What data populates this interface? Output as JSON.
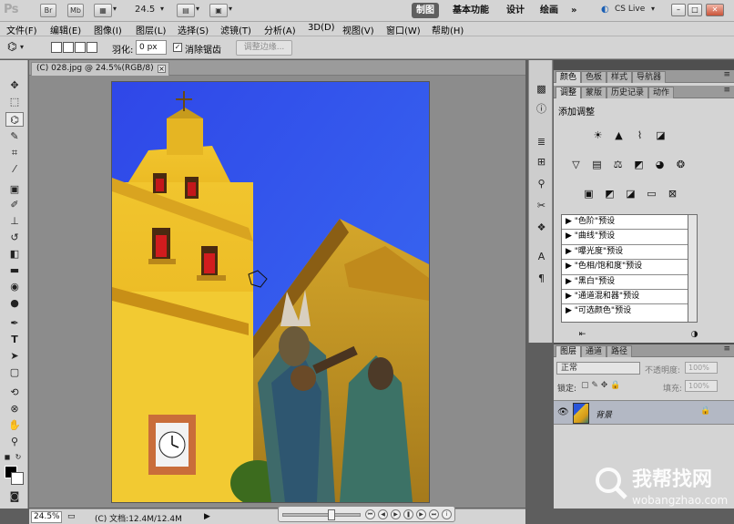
{
  "appbar": {
    "logo": "Ps",
    "br": "Br",
    "mb": "Mb",
    "zoom": "24.5",
    "workspaces": [
      "制图",
      "基本功能",
      "设计",
      "绘画"
    ],
    "more": "»",
    "cs_live": "CS Live"
  },
  "menus": [
    "文件(F)",
    "编辑(E)",
    "图像(I)",
    "图层(L)",
    "选择(S)",
    "滤镜(T)",
    "分析(A)",
    "3D(D)",
    "视图(V)",
    "窗口(W)",
    "帮助(H)"
  ],
  "options": {
    "feather_label": "羽化:",
    "feather_value": "0 px",
    "antialias_label": "消除锯齿",
    "antialias_checked": "✓",
    "refine_edge": "调整边缘..."
  },
  "document": {
    "tab_title": "(C) 028.jpg @ 24.5%(RGB/8)"
  },
  "status": {
    "zoom": "24.5%",
    "doc_info": "(C) 文档:12.4M/12.4M"
  },
  "panels": {
    "top_tabs": [
      "颜色",
      "色板",
      "样式",
      "导航器"
    ],
    "adjust_tabs": [
      "调整",
      "蒙版",
      "历史记录",
      "动作"
    ],
    "adjust_title": "添加调整",
    "presets": [
      "\"色阶\"预设",
      "\"曲线\"预设",
      "\"曝光度\"预设",
      "\"色相/饱和度\"预设",
      "\"黑白\"预设",
      "\"通道混和器\"预设",
      "\"可选颜色\"预设"
    ],
    "layer_tabs": [
      "图层",
      "通道",
      "路径"
    ],
    "blend_mode": "正常",
    "opacity_label": "不透明度:",
    "opacity_value": "100%",
    "lock_label": "锁定:",
    "fill_label": "填充:",
    "fill_value": "100%",
    "layer_name": "背景"
  },
  "watermark": {
    "title": "我帮找网",
    "url": "wobangzhao.com"
  }
}
